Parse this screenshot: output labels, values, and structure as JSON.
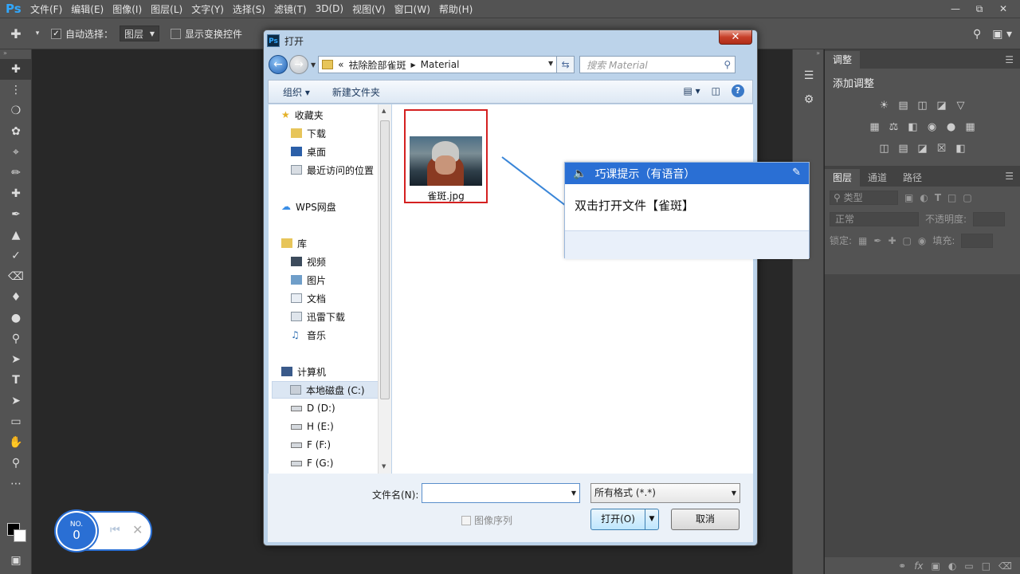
{
  "app": {
    "logo": "Ps"
  },
  "menu": [
    "文件(F)",
    "编辑(E)",
    "图像(I)",
    "图层(L)",
    "文字(Y)",
    "选择(S)",
    "滤镜(T)",
    "3D(D)",
    "视图(V)",
    "窗口(W)",
    "帮助(H)"
  ],
  "options": {
    "auto_select_label": "自动选择：",
    "auto_select_value": "图层",
    "transform_label": "显示变换控件"
  },
  "panels": {
    "adjust_tab": "调整",
    "add_adjust": "添加调整",
    "layers_tabs": [
      "图层",
      "通道",
      "路径"
    ],
    "kind_filter": "类型",
    "blend_mode": "正常",
    "opacity_label": "不透明度:",
    "lock_label": "锁定:",
    "fill_label": "填充:"
  },
  "dialog": {
    "title": "打开",
    "breadcrumb": [
      "祛除脸部雀斑",
      "Material"
    ],
    "breadcrumb_prefix": "«",
    "search_placeholder": "搜索 Material",
    "organize": "组织 ▾",
    "new_folder": "新建文件夹",
    "nav": {
      "favorites": "收藏夹",
      "downloads": "下载",
      "desktop": "桌面",
      "recent": "最近访问的位置",
      "wps": "WPS网盘",
      "library": "库",
      "videos": "视频",
      "pictures": "图片",
      "documents": "文档",
      "thunder": "迅雷下载",
      "music": "音乐",
      "computer": "计算机",
      "drive_c": "本地磁盘 (C:)",
      "drive_d": "D (D:)",
      "drive_e": "H (E:)",
      "drive_f": "F (F:)",
      "drive_g": "F (G:)"
    },
    "file_name": "雀斑.jpg",
    "filename_label": "文件名(N):",
    "filename_value": "",
    "format": "所有格式 (*.*)",
    "image_sequence": "图像序列",
    "open_btn": "打开(O)",
    "cancel_btn": "取消"
  },
  "hint": {
    "title": "巧课提示（有语音）",
    "text": "双击打开文件【雀斑】"
  },
  "step": {
    "label": "NO.",
    "value": "0"
  },
  "colors": {
    "ps_bg": "#282828",
    "ps_panel": "#535353",
    "accent": "#2a6fd4",
    "highlight": "#d42020"
  }
}
